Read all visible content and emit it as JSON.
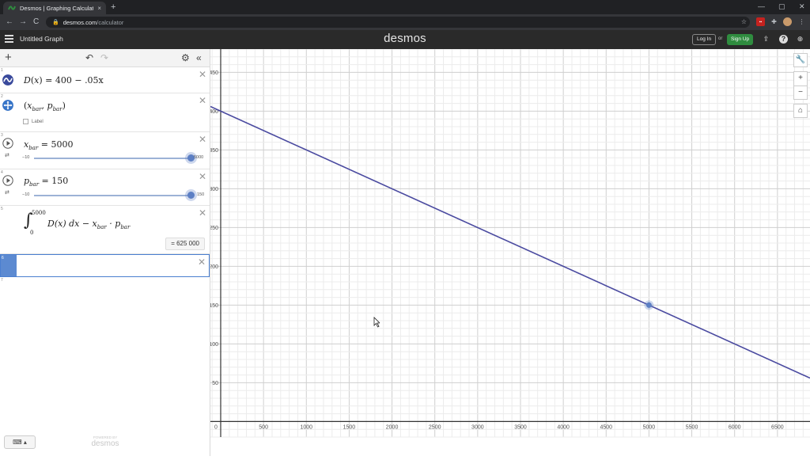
{
  "browser": {
    "tab_title": "Desmos | Graphing Calculator",
    "tab_close": "×",
    "new_tab": "+",
    "url_domain": "desmos.com",
    "url_path": "/calculator",
    "ext_badge": "▪▪",
    "window_controls": [
      "—",
      "▢",
      "✕"
    ],
    "nav": [
      "←",
      "→",
      "C"
    ]
  },
  "header": {
    "graph_title": "Untitled Graph",
    "brand": "desmos",
    "login_label": "Log In",
    "or_label": "or",
    "signup_label": "Sign Up",
    "share_icon": "⇪",
    "help_icon": "?",
    "globe_icon": "⊕"
  },
  "toolbar": {
    "add": "+",
    "undo": "↶",
    "redo": "↷",
    "settings": "⚙",
    "collapse": "«"
  },
  "expressions": [
    {
      "index": "1",
      "func": "D",
      "arg": "x",
      "rhs": "400 − .05x",
      "color": "#3a4a9c"
    },
    {
      "index": "2",
      "x_var": "x",
      "x_sub": "bar",
      "y_var": "p",
      "y_sub": "bar",
      "label_text": "Label",
      "color": "#3875c8"
    },
    {
      "index": "3",
      "var": "x",
      "sub": "bar",
      "value": "5000",
      "min": "−10",
      "max": "5000",
      "fraction": 1.0
    },
    {
      "index": "4",
      "var": "p",
      "sub": "bar",
      "value": "150",
      "min": "−10",
      "max": "150",
      "fraction": 1.0
    },
    {
      "index": "5",
      "upper": "5000",
      "lower": "0",
      "integrand": "D(x) dx − x",
      "sub1": "bar",
      "mid": " · p",
      "sub2": "bar",
      "result": "=  625 000"
    },
    {
      "index": "6"
    },
    {
      "index": "7"
    }
  ],
  "footer": {
    "keyboard": "⌨ ▴",
    "powered_by": "POWERED BY",
    "powered_brand": "desmos"
  },
  "graph_tools": {
    "wrench": "🔧",
    "zoom_in": "+",
    "zoom_out": "−",
    "home": "⌂"
  },
  "chart_data": {
    "type": "line",
    "title": "",
    "xlabel": "",
    "ylabel": "",
    "xlim": [
      -120,
      6880
    ],
    "ylim": [
      -20,
      480
    ],
    "x_ticks": [
      0,
      500,
      1000,
      1500,
      2000,
      2500,
      3000,
      3500,
      4000,
      4500,
      5000,
      5500,
      6000,
      6500
    ],
    "y_ticks": [
      50,
      100,
      150,
      200,
      250,
      300,
      350,
      400,
      450
    ],
    "grid": true,
    "series": [
      {
        "x": [
          -120,
          6880
        ],
        "y": [
          406,
          56
        ],
        "color": "#4a4aa0"
      }
    ],
    "points": [
      {
        "x": 5000,
        "y": 150,
        "color": "#5c7fc4"
      }
    ]
  }
}
